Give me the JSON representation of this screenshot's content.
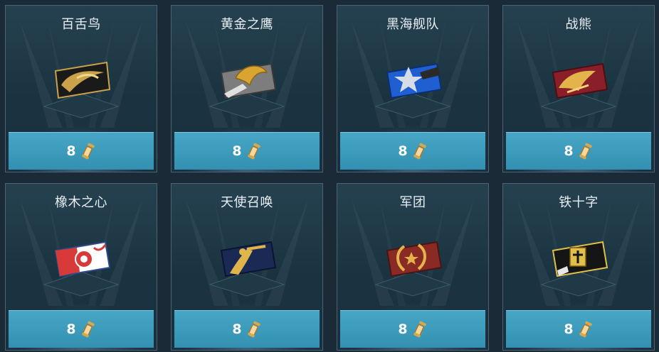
{
  "items": [
    {
      "name": "百舌鸟",
      "price": "8",
      "icon": "camo-shrike-icon",
      "colors": [
        "#1a1a1a",
        "#c9a24a"
      ]
    },
    {
      "name": "黄金之鹰",
      "price": "8",
      "icon": "camo-golden-eagle-icon",
      "colors": [
        "#8a8a8a",
        "#d9a530"
      ]
    },
    {
      "name": "黑海舰队",
      "price": "8",
      "icon": "camo-black-sea-fleet-icon",
      "colors": [
        "#1f5fd1",
        "#cfd8e6"
      ]
    },
    {
      "name": "战熊",
      "price": "8",
      "icon": "camo-war-bear-icon",
      "colors": [
        "#8a1f2a",
        "#e2b44a"
      ]
    },
    {
      "name": "橡木之心",
      "price": "8",
      "icon": "camo-heart-of-oak-icon",
      "colors": [
        "#d83a3a",
        "#ffffff"
      ]
    },
    {
      "name": "天使召唤",
      "price": "8",
      "icon": "camo-angel-call-icon",
      "colors": [
        "#1a2a55",
        "#e0b54a"
      ]
    },
    {
      "name": "军团",
      "price": "8",
      "icon": "camo-legion-icon",
      "colors": [
        "#8a2a24",
        "#e4b34a"
      ]
    },
    {
      "name": "铁十字",
      "price": "8",
      "icon": "camo-iron-cross-icon",
      "colors": [
        "#151515",
        "#e0c04a"
      ]
    }
  ],
  "currency_icon": "scroll-icon"
}
